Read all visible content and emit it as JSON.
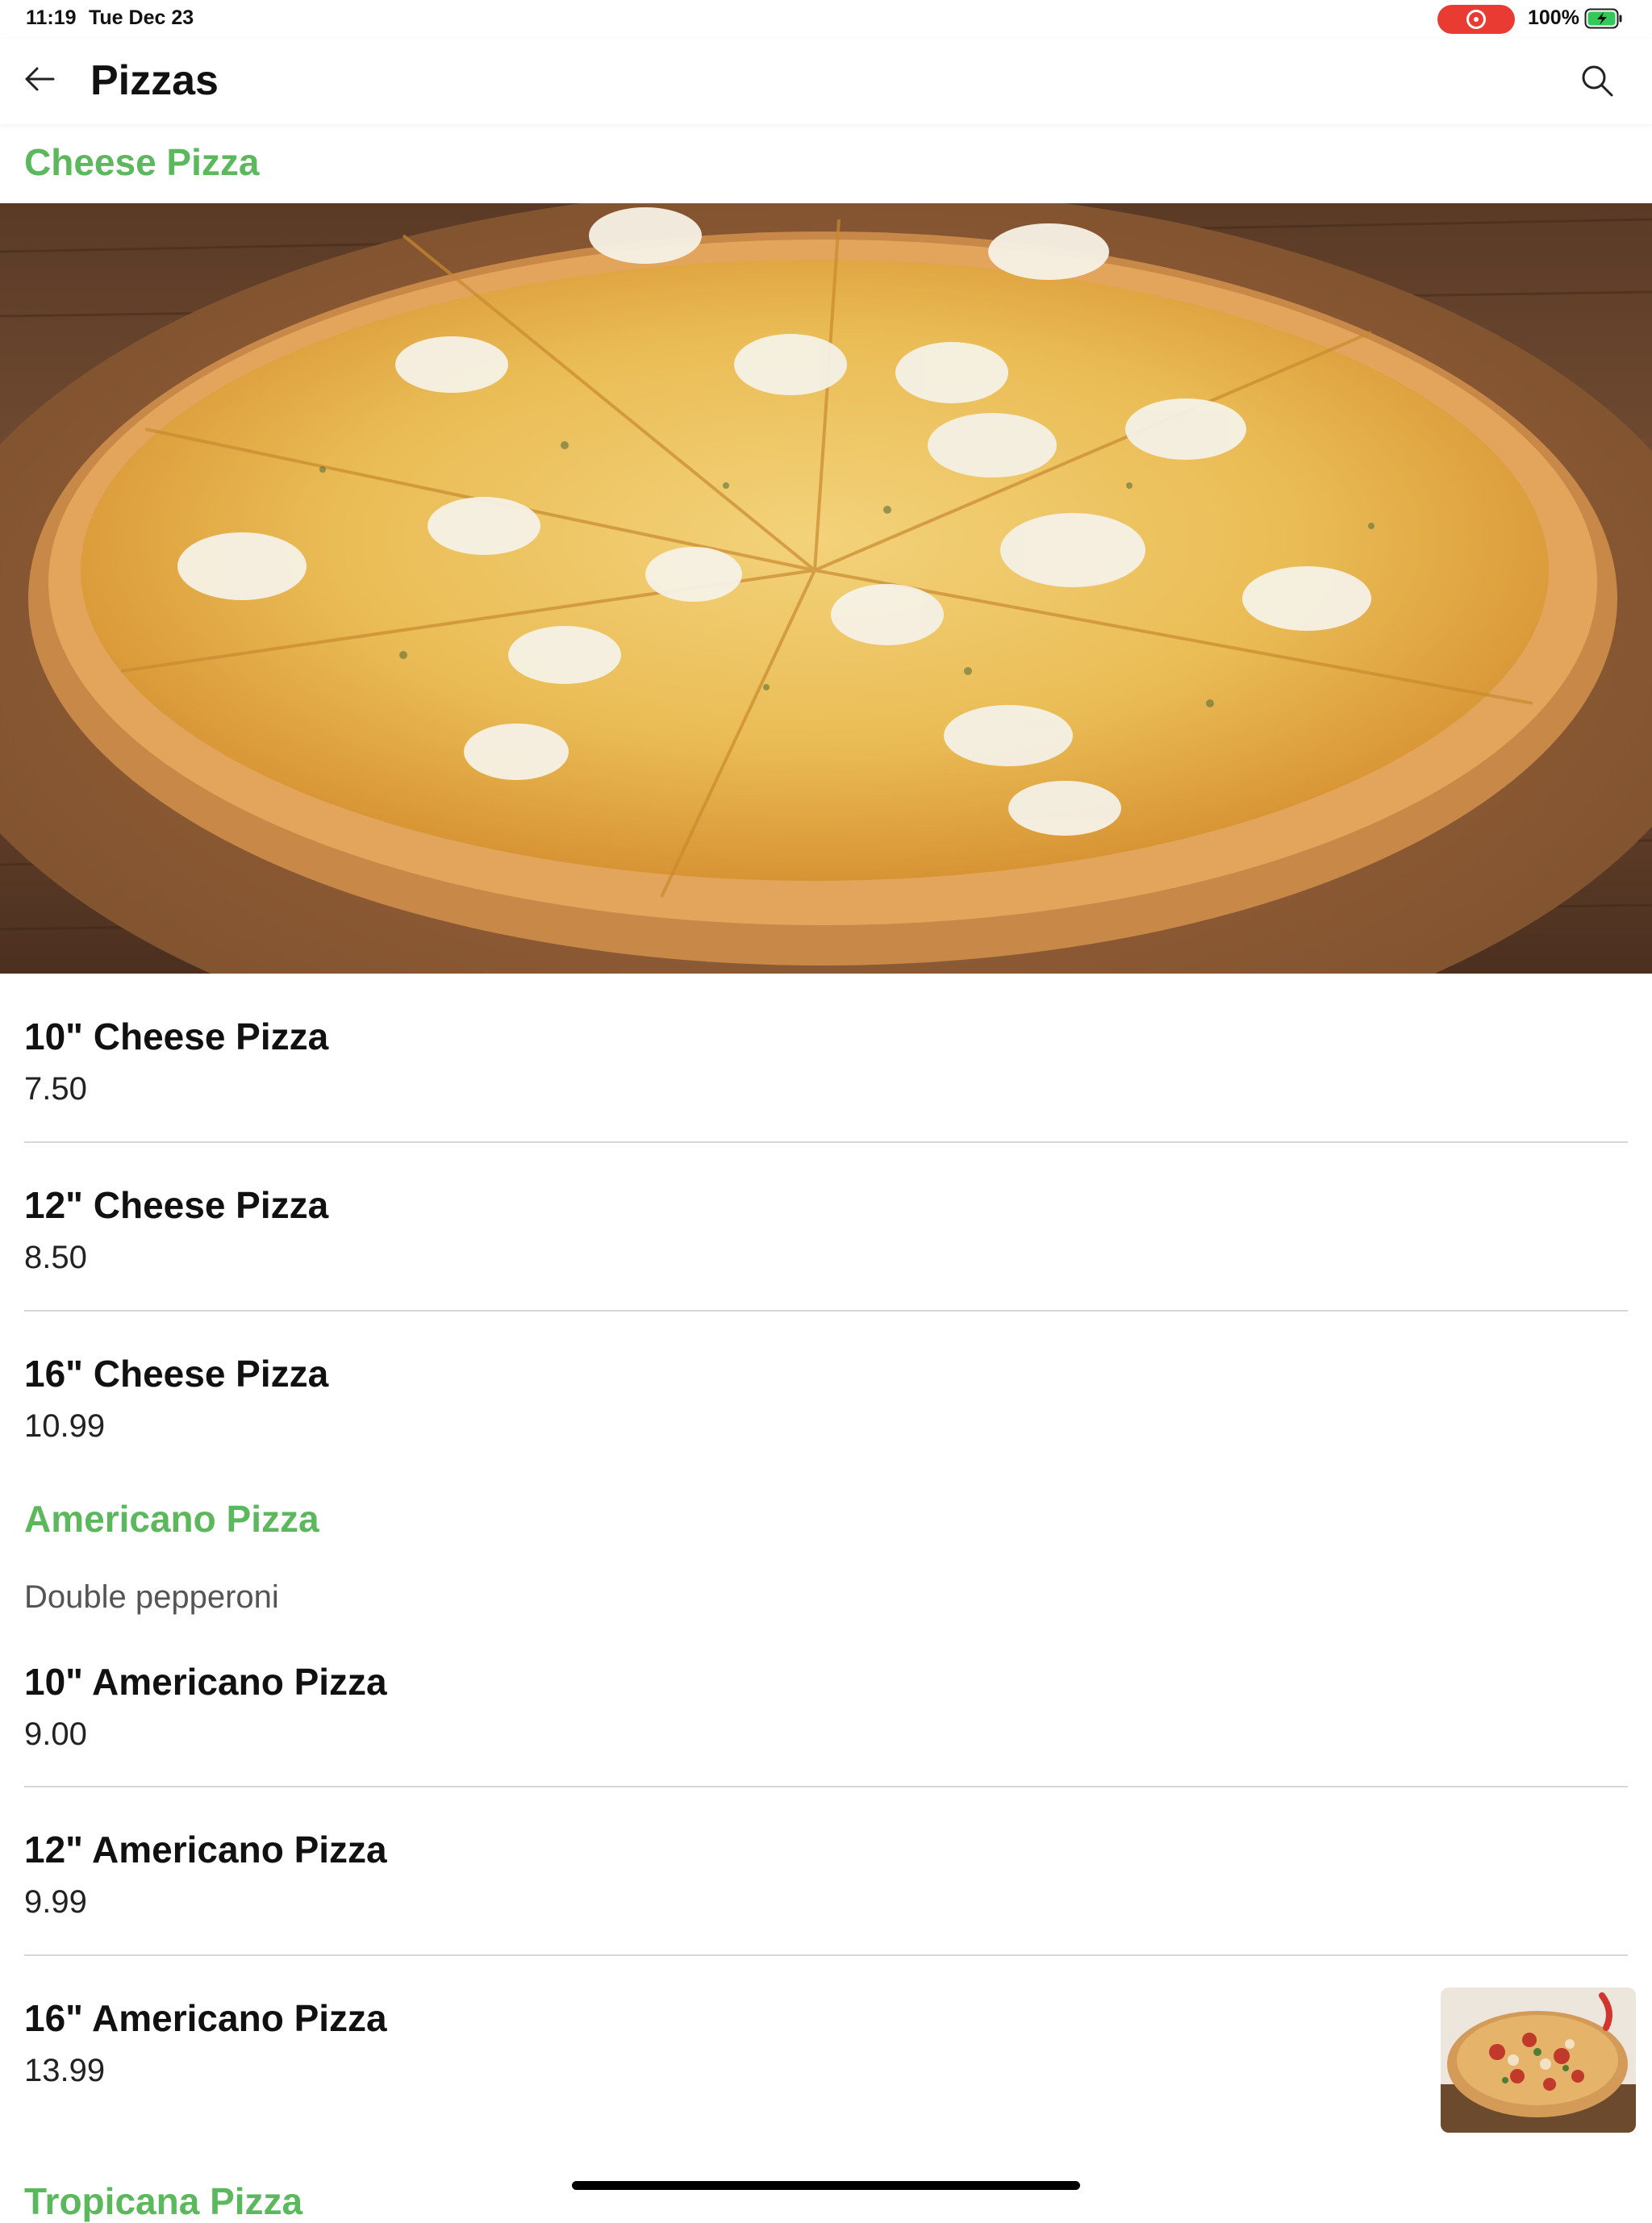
{
  "status_bar": {
    "time": "11:19",
    "date": "Tue Dec 23",
    "battery_percent": "100%",
    "recording_color": "#ea3b33",
    "battery_color": "#34c759"
  },
  "header": {
    "title": "Pizzas",
    "back_icon": "arrow-left-icon",
    "search_icon": "search-icon"
  },
  "accent_color": "#5cb85c",
  "sections": [
    {
      "title": "Cheese Pizza",
      "items": [
        {
          "name": "10\" Cheese Pizza",
          "price": "7.50"
        },
        {
          "name": "12\" Cheese Pizza",
          "price": "8.50"
        },
        {
          "name": "16\" Cheese Pizza",
          "price": "10.99"
        }
      ]
    },
    {
      "title": "Americano Pizza",
      "description": "Double pepperoni",
      "items": [
        {
          "name": "10\" Americano Pizza",
          "price": "9.00"
        },
        {
          "name": "12\" Americano Pizza",
          "price": "9.99"
        },
        {
          "name": "16\" Americano Pizza",
          "price": "13.99"
        }
      ]
    },
    {
      "title": "Tropicana Pizza"
    }
  ]
}
